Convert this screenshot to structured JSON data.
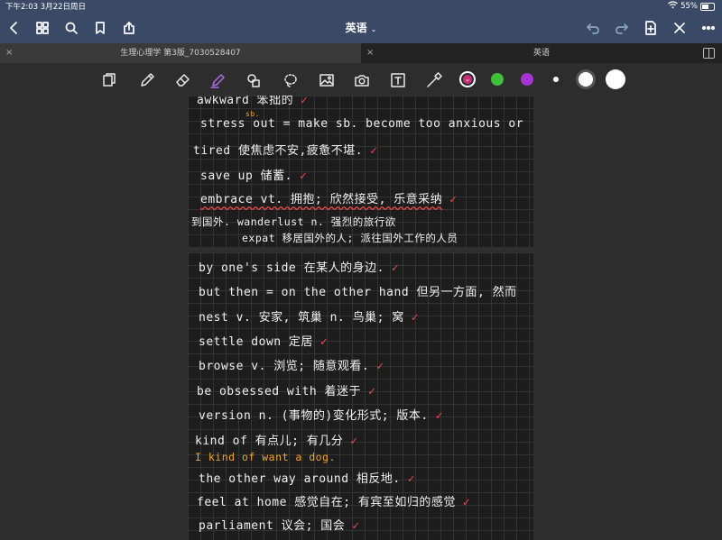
{
  "status": {
    "time": "下午2:03",
    "date": "3月22日周日",
    "battery": "55%",
    "battery_level": 0.55
  },
  "nav": {
    "title": "英语"
  },
  "tabs": [
    {
      "label": "生理心理学 第3版_7030528407"
    },
    {
      "label": "英语"
    }
  ],
  "toolbar": {
    "bluetooth_glyph": "✱",
    "colors": [
      "#cc2f7a",
      "#3fbf3a",
      "#a435d1",
      "#ffffff"
    ]
  },
  "page1": {
    "lines": [
      "awkward 笨拙的",
      "stress out = make sb. become too anxious or",
      "tired 使焦虑不安,疲惫不堪.",
      "save up 储蓄.",
      "embrace vt. 拥抱; 欣然接受, 乐意采纳",
      "到国外. wanderlust n. 强烈的旅行欲",
      "expat 移居国外的人; 派往国外工作的人员"
    ],
    "annotation": "sb."
  },
  "page2": {
    "lines": [
      "by one's side 在某人的身边.",
      "but then = on the other hand 但另一方面, 然而",
      "nest v. 安家, 筑巢 n. 鸟巢; 窝",
      "settle down 定居",
      "browse v. 浏览; 随意观看.",
      "be obsessed with 着迷于",
      "version n. (事物的)变化形式; 版本.",
      "kind of 有点儿; 有几分",
      "I kind of want a dog.",
      "the other way around 相反地.",
      "feel at home 感觉自在; 有宾至如归的感觉",
      "parliament 议会; 国会"
    ]
  }
}
